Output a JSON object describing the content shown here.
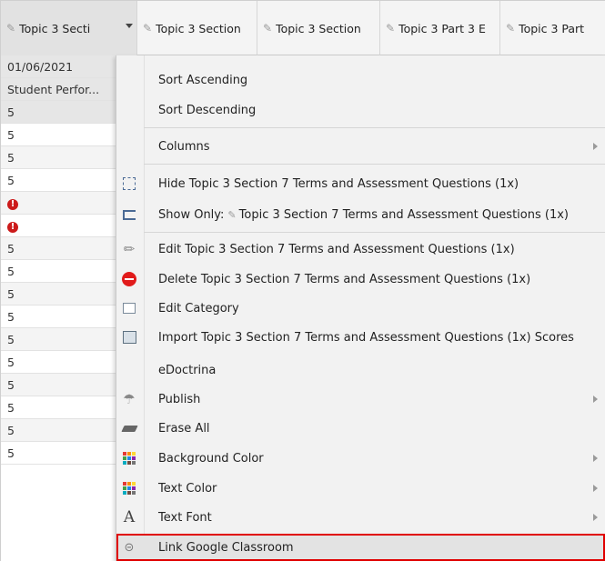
{
  "header": {
    "cells": [
      {
        "label": "Topic 3 Secti"
      },
      {
        "label": "Topic 3 Section"
      },
      {
        "label": "Topic 3 Section"
      },
      {
        "label": "Topic 3 Part 3 E"
      },
      {
        "label": "Topic 3 Part"
      }
    ]
  },
  "left_column": {
    "rows": [
      {
        "text": "01/06/2021"
      },
      {
        "text": "Student Perfor..."
      },
      {
        "text": "5"
      },
      {
        "text": "5"
      },
      {
        "text": "5"
      },
      {
        "text": "5"
      },
      {
        "text": ""
      },
      {
        "text": ""
      },
      {
        "text": "5"
      },
      {
        "text": "5"
      },
      {
        "text": "5"
      },
      {
        "text": "5"
      },
      {
        "text": "5"
      },
      {
        "text": "5"
      },
      {
        "text": "5"
      },
      {
        "text": "5"
      },
      {
        "text": "5"
      },
      {
        "text": "5"
      }
    ]
  },
  "menu": {
    "sort_ascending": "Sort Ascending",
    "sort_descending": "Sort Descending",
    "columns": "Columns",
    "hide": "Hide Topic 3 Section 7 Terms and Assessment Questions (1x)",
    "show_only_prefix": "Show Only:",
    "show_only_suffix": "Topic 3 Section 7 Terms and Assessment Questions (1x)",
    "edit": "Edit Topic 3 Section 7 Terms and Assessment Questions (1x)",
    "delete": "Delete Topic 3 Section 7 Terms and Assessment Questions (1x)",
    "edit_category": "Edit Category",
    "import": "Import Topic 3 Section 7 Terms and Assessment Questions (1x) Scores",
    "edoctrina": "eDoctrina",
    "publish": "Publish",
    "erase_all": "Erase All",
    "background_color": "Background Color",
    "text_color": "Text Color",
    "text_font": "Text Font",
    "link_google_classroom": "Link Google Classroom"
  },
  "colors": {
    "highlight_border": "#e00000",
    "delete_icon": "#e11b1b",
    "alert_icon": "#cc1a1a"
  }
}
